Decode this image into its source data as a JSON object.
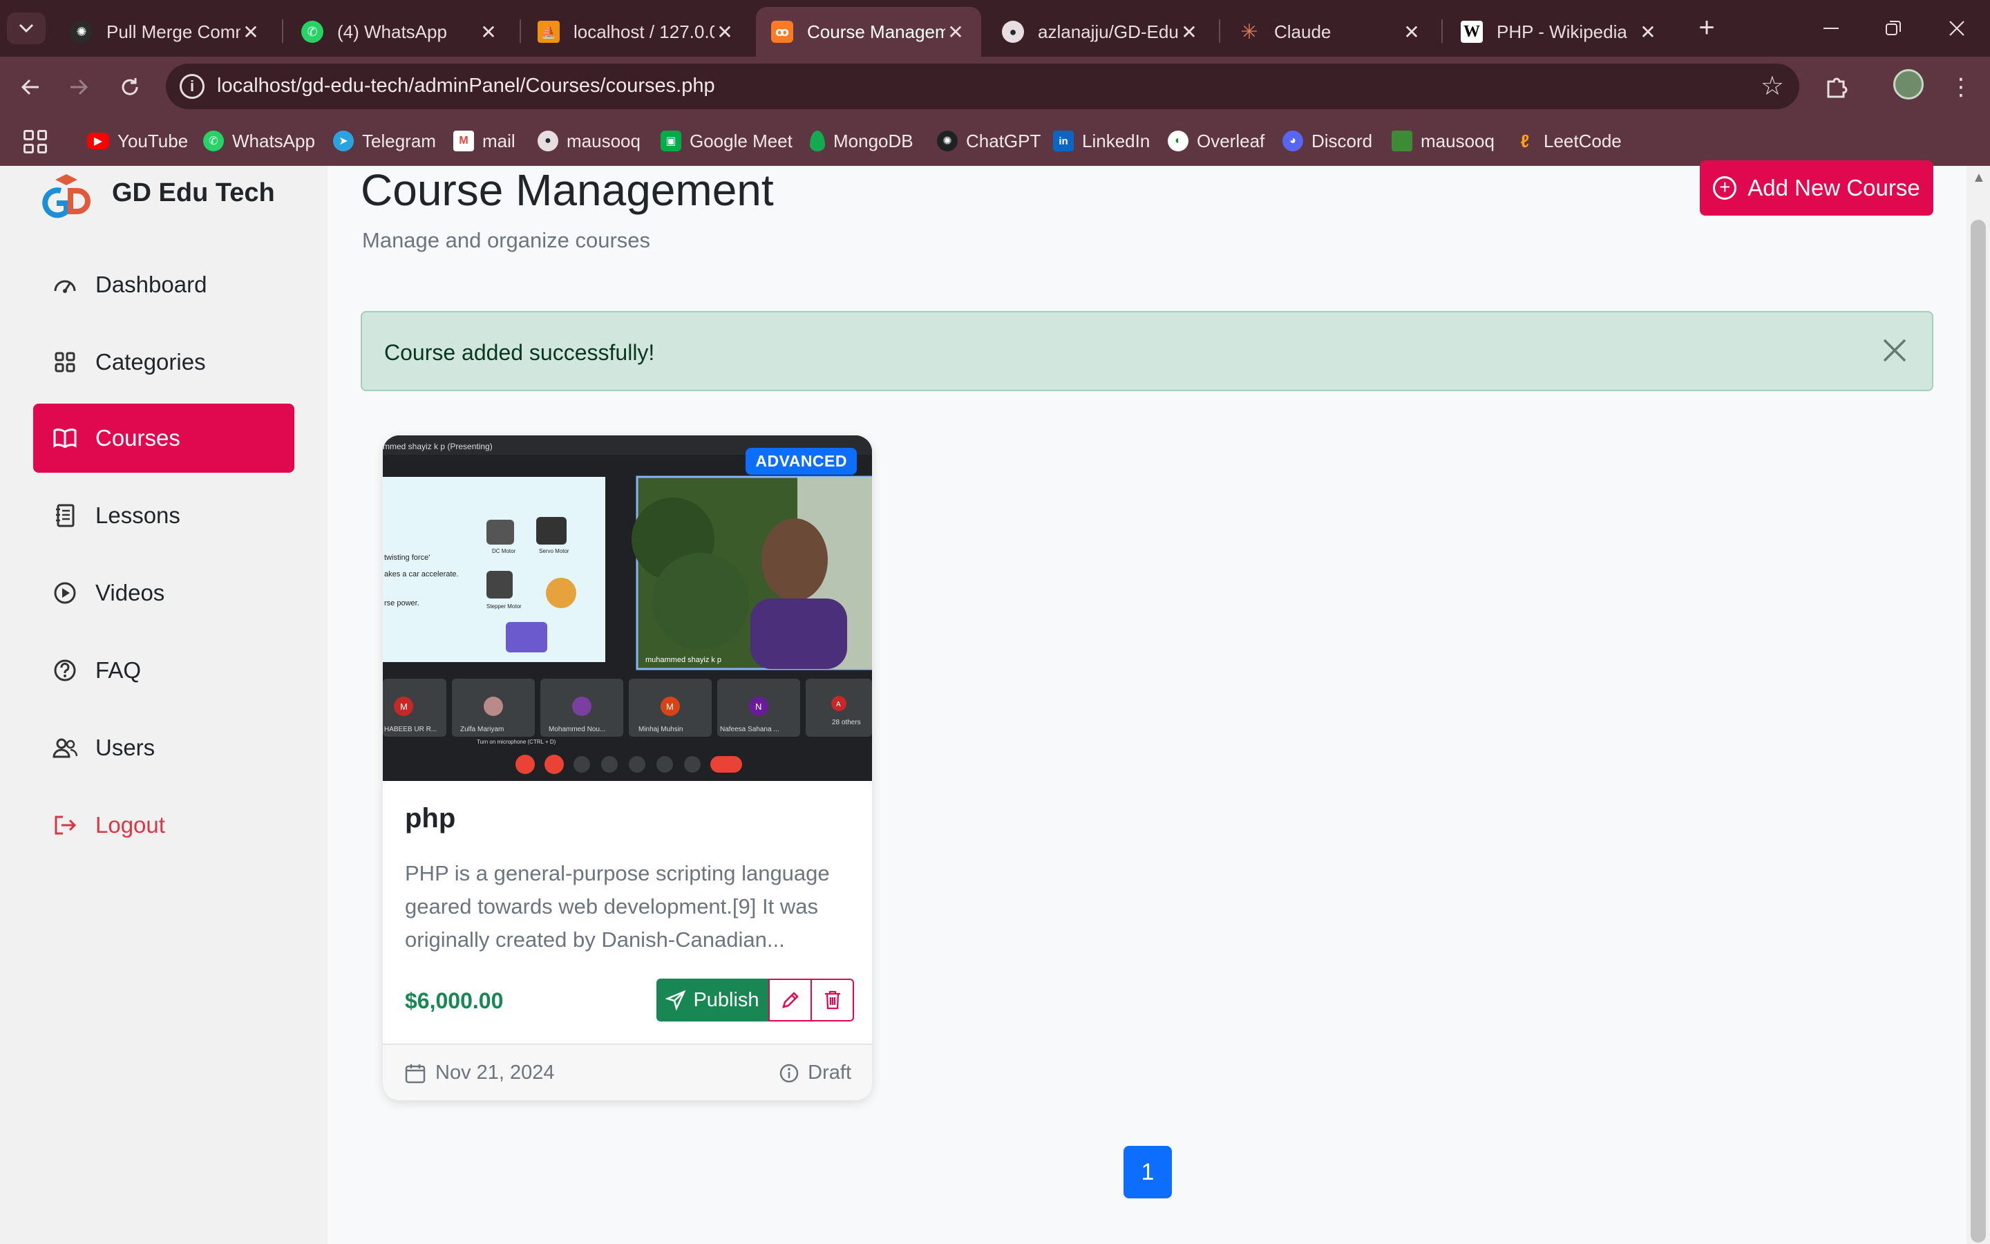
{
  "browser": {
    "tabs": [
      {
        "title": "Pull Merge Commi",
        "icon": "chatgpt-icon"
      },
      {
        "title": "(4) WhatsApp",
        "icon": "whatsapp-icon"
      },
      {
        "title": "localhost / 127.0.0.",
        "icon": "phpmyadmin-icon"
      },
      {
        "title": "Course Manageme",
        "icon": "xampp-icon",
        "active": true
      },
      {
        "title": "azlanajju/GD-Edu-",
        "icon": "github-icon"
      },
      {
        "title": "Claude",
        "icon": "claude-icon"
      },
      {
        "title": "PHP - Wikipedia",
        "icon": "wikipedia-icon"
      }
    ],
    "url": "localhost/gd-edu-tech/adminPanel/Courses/courses.php",
    "bookmarks": [
      {
        "label": "YouTube",
        "color": "#ff0000"
      },
      {
        "label": "WhatsApp",
        "color": "#25d366"
      },
      {
        "label": "Telegram",
        "color": "#2aa3e0"
      },
      {
        "label": "mail",
        "color": "#ea4335"
      },
      {
        "label": "mausooq",
        "color": "#24292f"
      },
      {
        "label": "Google Meet",
        "color": "#00ac47"
      },
      {
        "label": "MongoDB",
        "color": "#13aa52"
      },
      {
        "label": "ChatGPT",
        "color": "#202123"
      },
      {
        "label": "LinkedIn",
        "color": "#0a66c2"
      },
      {
        "label": "Overleaf",
        "color": "#138a36"
      },
      {
        "label": "Discord",
        "color": "#5865f2"
      },
      {
        "label": "mausooq",
        "color": "#3d8b37"
      },
      {
        "label": "LeetCode",
        "color": "#ffa116"
      }
    ]
  },
  "sidebar": {
    "brand": "GD Edu Tech",
    "items": [
      {
        "label": "Dashboard",
        "icon": "dashboard-icon"
      },
      {
        "label": "Categories",
        "icon": "grid-icon"
      },
      {
        "label": "Courses",
        "icon": "book-icon",
        "active": true
      },
      {
        "label": "Lessons",
        "icon": "journal-icon"
      },
      {
        "label": "Videos",
        "icon": "play-circle-icon"
      },
      {
        "label": "FAQ",
        "icon": "question-circle-icon"
      },
      {
        "label": "Users",
        "icon": "users-icon"
      },
      {
        "label": "Logout",
        "icon": "logout-icon"
      }
    ]
  },
  "main": {
    "title": "Course Management",
    "subtitle": "Manage and organize courses",
    "add_button": "Add New Course",
    "alert": "Course added successfully!",
    "pagination": [
      "1"
    ]
  },
  "courses": [
    {
      "level": "ADVANCED",
      "title": "php",
      "description": "PHP is a general-purpose scripting language geared towards web development.[9] It was originally created by Danish-Canadian...",
      "price": "$6,000.00",
      "publish_label": "Publish",
      "date": "Nov 21, 2024",
      "status": "Draft",
      "thumbnail": {
        "presenter_header": "mmed shayiz k p (Presenting)",
        "presenter_name": "muhammed shayiz k p",
        "slide_text": [
          "twisting force'",
          "akes a car accelerate.",
          "rse power."
        ],
        "slide_labels": [
          "DC Motor",
          "Servo Motor",
          "Stepper Motor"
        ],
        "participants": [
          {
            "initial": "M",
            "name": "HABEEB UR R...",
            "color": "#c62828"
          },
          {
            "initial": "",
            "name": "Zulfa Mariyam",
            "color": "#b88a8a"
          },
          {
            "initial": "",
            "name": "Mohammed Nou...",
            "color": "#7b3fa0"
          },
          {
            "initial": "M",
            "name": "Minhaj Muhsin",
            "color": "#d84315"
          },
          {
            "initial": "N",
            "name": "Nafeesa Sahana ...",
            "color": "#6a1b9a"
          },
          {
            "initial": "A",
            "name": "28 others",
            "color": "#c62828"
          }
        ],
        "mic_tooltip": "Turn on microphone (CTRL + D)"
      }
    }
  ],
  "colors": {
    "accent": "#e0084f",
    "success": "#198754",
    "primary": "#0d6efd",
    "alert_bg": "#d1e7dd"
  }
}
